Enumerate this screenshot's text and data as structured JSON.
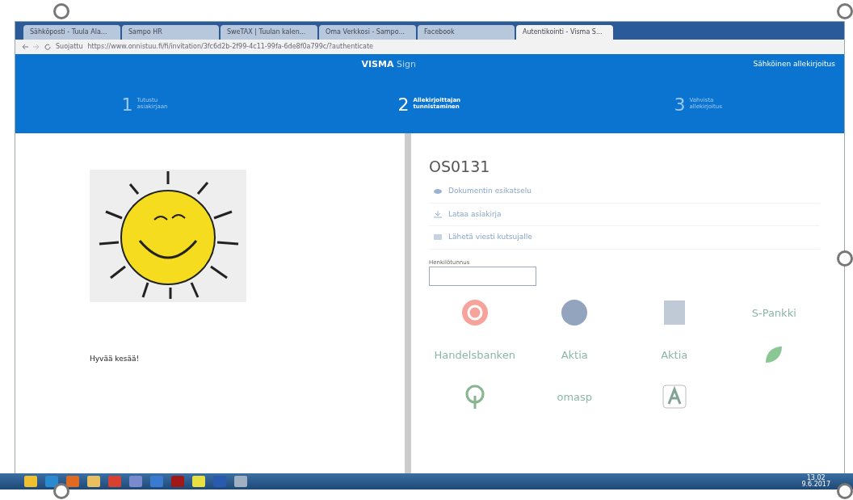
{
  "browser": {
    "tabs": [
      {
        "title": "Sähköposti - Tuula Ala...",
        "selected": false
      },
      {
        "title": "Sampo HR",
        "selected": false
      },
      {
        "title": "SweTAX | Tuulan kalen...",
        "selected": false
      },
      {
        "title": "Oma Verkkosi - Sampo...",
        "selected": false
      },
      {
        "title": "Facebook",
        "selected": false
      },
      {
        "title": "Autentikointi - Visma S...",
        "selected": true
      }
    ],
    "secure_label": "Suojattu",
    "url": "https://www.onnistuu.fi/fi/invitation/3fc6d2b-2f99-4c11-99fa-6de8f0a799c/?authenticate"
  },
  "header": {
    "brand": "VISMA",
    "product": "Sign",
    "right_title": "Sähköinen allekirjoitus"
  },
  "steps": [
    {
      "number": "1",
      "label": "Tutustu asiakirjaan",
      "selected": false
    },
    {
      "number": "2",
      "label": "Allekirjoittajan tunnistaminen",
      "selected": true
    },
    {
      "number": "3",
      "label": "Vahvista allekirjoitus",
      "selected": false
    }
  ],
  "document": {
    "caption": "Hyvää kesää!"
  },
  "panel": {
    "title": "OS0131",
    "links": [
      {
        "kind": "eye",
        "label": "Dokumentin esikatselu"
      },
      {
        "kind": "download",
        "label": "Lataa asiakirja"
      },
      {
        "kind": "message",
        "label": "Lähetä viesti kutsujalle"
      }
    ],
    "field_label": "Henkilötunnus",
    "banks": [
      {
        "kind": "op"
      },
      {
        "kind": "nordea"
      },
      {
        "kind": "danske"
      },
      {
        "kind": "text",
        "label": "S-Pankki"
      },
      {
        "kind": "text",
        "label": "Handelsbanken"
      },
      {
        "kind": "text",
        "label": "Aktia"
      },
      {
        "kind": "text",
        "label": "Aktia"
      },
      {
        "kind": "leaf"
      },
      {
        "kind": "tree"
      },
      {
        "kind": "text",
        "label": "omasp"
      },
      {
        "kind": "alandsbanken"
      }
    ]
  },
  "taskbar": {
    "time": "13.02",
    "date": "9.6.2017"
  }
}
